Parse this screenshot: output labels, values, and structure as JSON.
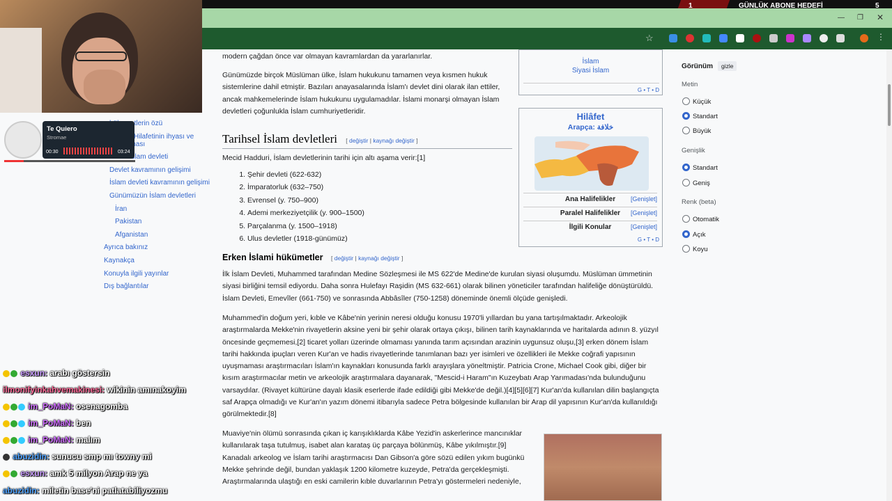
{
  "overlay": {
    "goal_number": "1",
    "goal_label": "GÜNLÜK ABONE HEDEFİ",
    "goal_value": "5"
  },
  "music": {
    "title": "Te Quiero",
    "artist": "Stromae",
    "elapsed": "00:30",
    "duration": "03:24",
    "progress": 0.15
  },
  "sidebar": {
    "items": [
      "hükumetlerin özü",
      "Hilafetinin ihyası ve",
      "kaldırılması",
      "Modern İslam devleti",
      "Devlet kavramının gelişimi",
      "İslam devleti kavramının gelişimi",
      "Günümüzün İslam devletleri",
      "İran",
      "Pakistan",
      "Afganistan",
      "Ayrıca bakınız",
      "Kaynakça",
      "Konuyla ilgili yayınlar",
      "Dış bağlantılar"
    ]
  },
  "article": {
    "p0": "modern çağdan önce var olmayan kavramlardan da yararlanırlar.",
    "p1": "Günümüzde birçok Müslüman ülke, İslam hukukunu tamamen veya kısmen hukuk sistemlerine dahil etmiştir. Bazıları anayasalarında İslam'ı devlet dini olarak ilan ettiler, ancak mahkemelerinde İslam hukukunu uygulamadılar. İslami monarşi olmayan İslam devletleri çoğunlukla İslam cumhuriyetleridir.",
    "h2": "Tarihsel İslam devletleri",
    "edit_a": "değiştir",
    "edit_sep": " | ",
    "edit_b": "kaynağı değiştir",
    "intro": "Mecid Hadduri, İslam devletlerinin tarihi için altı aşama verir:[1]",
    "list": [
      "Şehir devleti (622-632)",
      "İmparatorluk (632–750)",
      "Evrensel (y. 750–900)",
      "Ademi merkeziyetçilik (y. 900–1500)",
      "Parçalanma (y. 1500–1918)",
      "Ulus devletler (1918-günümüz)"
    ],
    "h3": "Erken İslami hükümetler",
    "p2": "İlk İslam Devleti, Muhammed tarafından Medine Sözleşmesi ile MS 622'de Medine'de kurulan siyasi oluşumdu. Müslüman ümmetinin siyasi birliğini temsil ediyordu. Daha sonra Hulefayı Raşidin (MS 632-661) olarak bilinen yöneticiler tarafından halifeliğe dönüştürüldü. İslam Devleti, Emevîler (661-750) ve sonrasında Abbâsîler (750-1258) döneminde önemli ölçüde genişledi.",
    "p3": "Muhammed'in doğum yeri, kıble ve Kâbe'nin yerinin neresi olduğu konusu 1970'li yıllardan bu yana tartışılmaktadır. Arkeolojik araştırmalarda Mekke'nin rivayetlerin aksine yeni bir şehir olarak ortaya çıkışı, bilinen tarih kaynaklarında ve haritalarda adının 8. yüzyıl öncesinde geçmemesi,[2] ticaret yolları üzerinde olmaması yanında tarım açısından arazinin uygunsuz oluşu,[3] erken dönem İslam tarihi hakkında ipuçları veren Kur'an ve hadis rivayetlerinde tanımlanan bazı yer isimleri ve özellikleri ile Mekke coğrafi yapısının uyuşmaması araştırmacıları İslam'ın kaynakları konusunda farklı arayışlara yöneltmiştir. Patricia Crone, Michael Cook gibi, diğer bir kısım araştırmacılar metin ve arkeolojik araştırmalara dayanarak, \"Mescid-i Haram\"ın Kuzeybatı Arap Yarımadası'nda bulunduğunu varsaydılar. (Rivayet kültürüne dayalı klasik eserlerde ifade edildiği gibi Mekke'de değil.)[4][5][6][7] Kur'an'da kullanılan dilin başlangıçta saf Arapça olmadığı ve Kur'an'ın yazım dönemi itibarıyla sadece Petra bölgesinde kullanılan bir Arap dil yapısının Kur'an'da kullanıldığı görülmektedir.[8]",
    "p4": "Muaviye'nin ölümü sonrasında çıkan iç karışıklıklarda Kâbe Yezid'in askerlerince mancınıklar kullanılarak taşa tutulmuş, isabet alan karataş üç parçaya bölünmüş, Kâbe yıkılmıştır.[9] Kanadalı arkeolog ve İslam tarihi araştırmacısı Dan Gibson'a göre sözü edilen yıkım bugünkü Mekke şehrinde değil, bundan yaklaşık 1200 kilometre kuzeyde, Petra'da gerçekleşmişti. Araştırmalarında ulaştığı en eski camilerin kıble duvarlarının Petra'yı göstermeleri nedeniyle,"
  },
  "infobox1": {
    "l1": "İslam",
    "l2": "Siyasi İslam",
    "gtd": "G • T • D"
  },
  "infobox2": {
    "title": "Hilâfet",
    "subtitle": "Arapça: خلافة",
    "rows": [
      "Ana Halifelikler",
      "Paralel Halifelikler",
      "İlgili Konular"
    ],
    "expand": "[Genişlet]",
    "gtd": "G • T • D"
  },
  "appearance": {
    "title": "Görünüm",
    "hide": "gizle",
    "text_h": "Metin",
    "text_opts": [
      "Küçük",
      "Standart",
      "Büyük"
    ],
    "text_sel": 1,
    "width_h": "Genişlik",
    "width_opts": [
      "Standart",
      "Geniş"
    ],
    "width_sel": 0,
    "color_h": "Renk (beta)",
    "color_opts": [
      "Otomatik",
      "Açık",
      "Koyu"
    ],
    "color_sel": 1
  },
  "chat": [
    {
      "user": "esxun:",
      "msg": "arabı göstersin"
    },
    {
      "user": "ilmonifyinkahvemakinesi:",
      "msg": "wikinin amınakoyim"
    },
    {
      "user": "im_PoMaN:",
      "msg": "osenagomba"
    },
    {
      "user": "im_PoMaN:",
      "msg": "ben"
    },
    {
      "user": "im_PoMaN:",
      "msg": "malım"
    },
    {
      "user": "abuzidin:",
      "msg": "sunucu smp mı towny mi"
    },
    {
      "user": "esxun:",
      "msg": "amk 5 milyon Arap ne ya"
    },
    {
      "user": "abuzidin:",
      "msg": "miletin base'ni patlatabiliyozmu"
    }
  ],
  "colors": {
    "link": "#3366cc",
    "accent": "#3366cc",
    "browser_bar": "#1e5a2e",
    "tabstrip": "#a7d7a7"
  }
}
